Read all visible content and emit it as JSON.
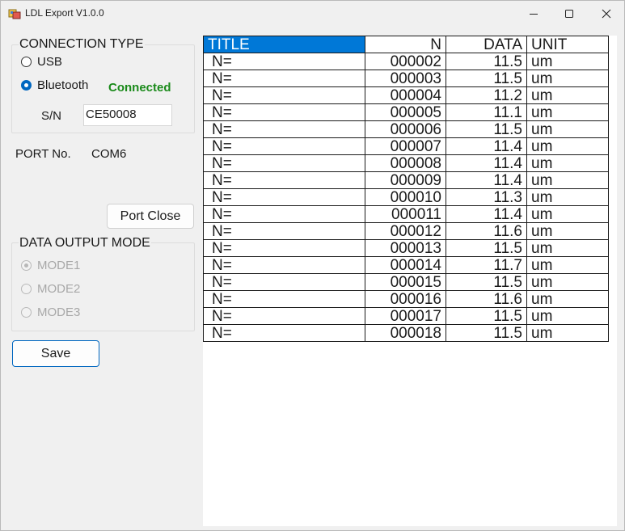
{
  "window": {
    "title": "LDL Export V1.0.0",
    "icons": {
      "app": "app-icon",
      "minimize": "minimize-icon",
      "maximize": "maximize-icon",
      "close": "close-icon"
    }
  },
  "connection": {
    "group_title": "CONNECTION TYPE",
    "options": [
      {
        "label": "USB",
        "checked": false
      },
      {
        "label": "Bluetooth",
        "checked": true
      }
    ],
    "status": "Connected",
    "status_color": "#1a8a1a",
    "sn_label": "S/N",
    "sn_value": "CE50008"
  },
  "port": {
    "label": "PORT No.",
    "value": "COM6",
    "close_button": "Port Close"
  },
  "output_mode": {
    "group_title": "DATA OUTPUT MODE",
    "options": [
      {
        "label": "MODE1",
        "checked": true,
        "enabled": false
      },
      {
        "label": "MODE2",
        "checked": false,
        "enabled": false
      },
      {
        "label": "MODE3",
        "checked": false,
        "enabled": false
      }
    ]
  },
  "save_button": "Save",
  "grid": {
    "columns": [
      "TITLE",
      "N",
      "DATA",
      "UNIT"
    ],
    "selected_header_color": "#0078d7",
    "rows": [
      [
        "N=",
        "000002",
        "11.5",
        "um"
      ],
      [
        "N=",
        "000003",
        "11.5",
        "um"
      ],
      [
        "N=",
        "000004",
        "11.2",
        "um"
      ],
      [
        "N=",
        "000005",
        "11.1",
        "um"
      ],
      [
        "N=",
        "000006",
        "11.5",
        "um"
      ],
      [
        "N=",
        "000007",
        "11.4",
        "um"
      ],
      [
        "N=",
        "000008",
        "11.4",
        "um"
      ],
      [
        "N=",
        "000009",
        "11.4",
        "um"
      ],
      [
        "N=",
        "000010",
        "11.3",
        "um"
      ],
      [
        "N=",
        "000011",
        "11.4",
        "um"
      ],
      [
        "N=",
        "000012",
        "11.6",
        "um"
      ],
      [
        "N=",
        "000013",
        "11.5",
        "um"
      ],
      [
        "N=",
        "000014",
        "11.7",
        "um"
      ],
      [
        "N=",
        "000015",
        "11.5",
        "um"
      ],
      [
        "N=",
        "000016",
        "11.6",
        "um"
      ],
      [
        "N=",
        "000017",
        "11.5",
        "um"
      ],
      [
        "N=",
        "000018",
        "11.5",
        "um"
      ]
    ]
  }
}
